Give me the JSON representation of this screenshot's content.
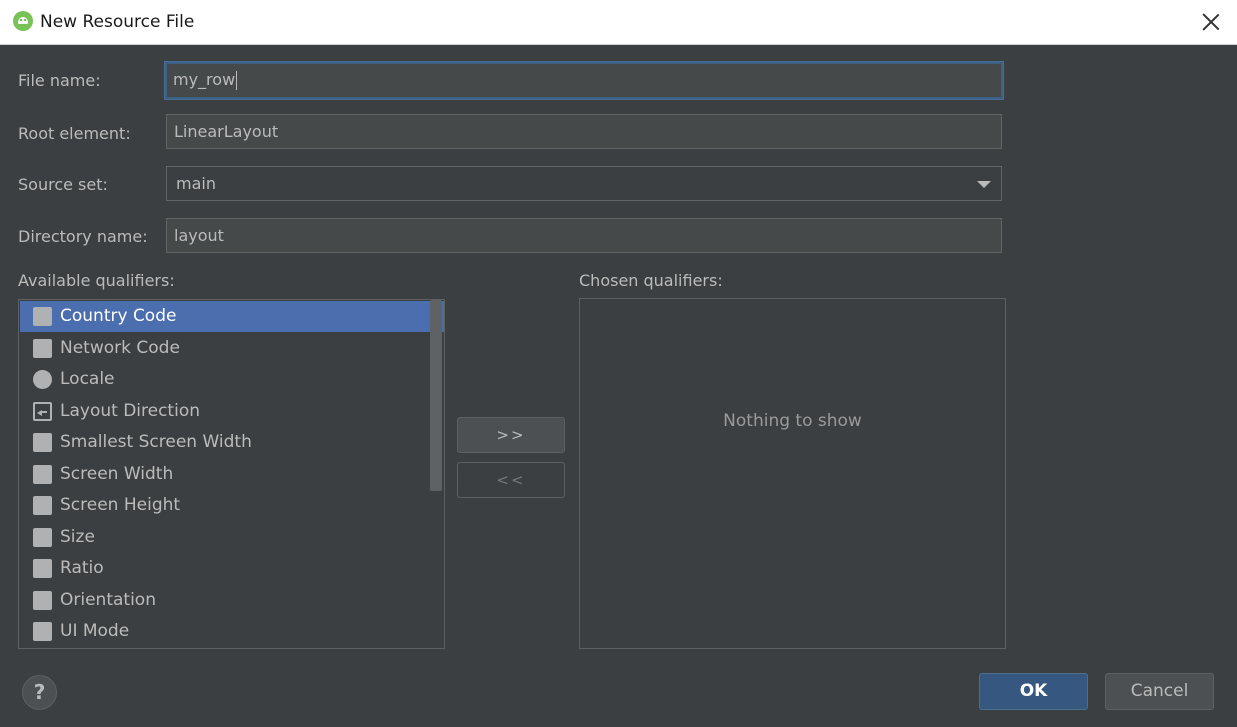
{
  "window": {
    "title": "New Resource File"
  },
  "form": {
    "file_name_label": "File name:",
    "file_name_value": "my_row",
    "root_element_label": "Root element:",
    "root_element_value": "LinearLayout",
    "source_set_label": "Source set:",
    "source_set_value": "main",
    "directory_name_label": "Directory name:",
    "directory_name_value": "layout"
  },
  "qualifiers": {
    "available_label": "Available qualifiers:",
    "chosen_label": "Chosen qualifiers:",
    "chosen_empty_text": "Nothing to show",
    "items": [
      {
        "label": "Country Code",
        "icon": "country-code-icon",
        "selected": true
      },
      {
        "label": "Network Code",
        "icon": "network-code-icon",
        "selected": false
      },
      {
        "label": "Locale",
        "icon": "globe-icon",
        "selected": false
      },
      {
        "label": "Layout Direction",
        "icon": "layout-direction-icon",
        "selected": false
      },
      {
        "label": "Smallest Screen Width",
        "icon": "smallest-screen-width-icon",
        "selected": false
      },
      {
        "label": "Screen Width",
        "icon": "screen-width-icon",
        "selected": false
      },
      {
        "label": "Screen Height",
        "icon": "screen-height-icon",
        "selected": false
      },
      {
        "label": "Size",
        "icon": "size-icon",
        "selected": false
      },
      {
        "label": "Ratio",
        "icon": "ratio-icon",
        "selected": false
      },
      {
        "label": "Orientation",
        "icon": "orientation-icon",
        "selected": false
      },
      {
        "label": "UI Mode",
        "icon": "ui-mode-icon",
        "selected": false
      }
    ],
    "add_label": ">>",
    "remove_label": "<<"
  },
  "footer": {
    "help_label": "?",
    "ok_label": "OK",
    "cancel_label": "Cancel"
  },
  "colors": {
    "background": "#3c3f41",
    "selection": "#4b6eaf",
    "ok_button": "#365880"
  }
}
